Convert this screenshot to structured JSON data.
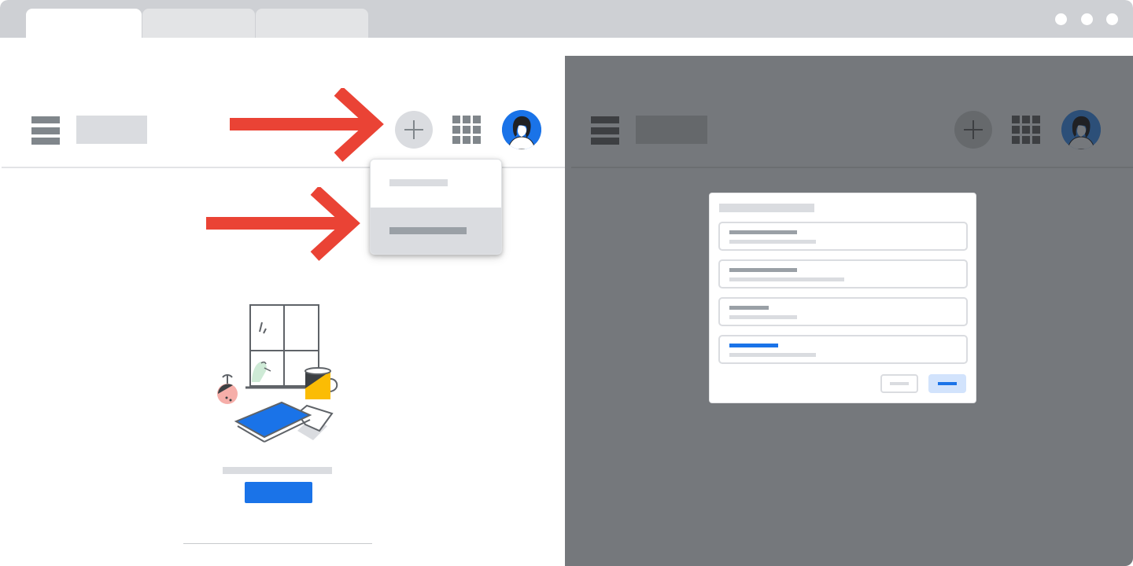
{
  "browser": {
    "tabs": [
      {
        "label": "",
        "state": "active"
      },
      {
        "label": "",
        "state": "inactive"
      },
      {
        "label": "",
        "state": "inactive"
      }
    ],
    "window_controls": [
      "dot-icon",
      "dot-icon",
      "dot-icon"
    ]
  },
  "left_panel": {
    "header": {
      "menu_icon": "hamburger-menu-icon",
      "logo": "logo-placeholder",
      "create_icon": "plus-icon",
      "apps_icon": "apps-grid-icon",
      "avatar_icon": "user-avatar-icon"
    },
    "create_menu": {
      "items": [
        {
          "label": "",
          "state": "default"
        },
        {
          "label": "",
          "state": "highlighted"
        }
      ]
    },
    "annotations": [
      "red-arrow-icon",
      "red-arrow-icon"
    ],
    "empty_state": {
      "illustration": "desk-illustration-icon",
      "caption": "",
      "cta_label": ""
    }
  },
  "right_panel": {
    "overlay": "dimmed",
    "dialog": {
      "title": "",
      "fields": [
        {
          "label": "",
          "value": "",
          "state": "default"
        },
        {
          "label": "",
          "value": "",
          "state": "default"
        },
        {
          "label": "",
          "value": "",
          "state": "default"
        },
        {
          "label": "",
          "value": "",
          "state": "focused"
        }
      ],
      "cancel_label": "",
      "confirm_label": ""
    }
  },
  "colors": {
    "accent_blue": "#1a73e8",
    "arrow_red": "#ea4335",
    "chrome_gray": "#ced0d4",
    "overlay_gray": "#75787c",
    "placeholder_gray": "#dadce0"
  }
}
